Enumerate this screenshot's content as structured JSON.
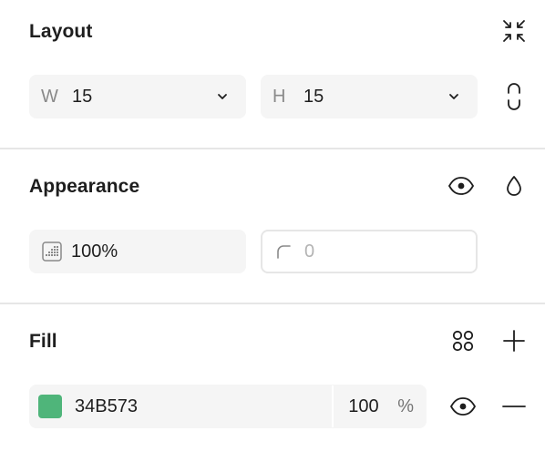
{
  "layout": {
    "title": "Layout",
    "width": {
      "prefix": "W",
      "value": "15"
    },
    "height": {
      "prefix": "H",
      "value": "15"
    },
    "icons": {
      "collapse": "collapse-icon",
      "constrain": "constrain-proportions-icon",
      "dropdown": "chevron-down-icon"
    }
  },
  "appearance": {
    "title": "Appearance",
    "opacity": {
      "value": "100%"
    },
    "corner_radius": {
      "placeholder": "0"
    },
    "icons": {
      "visibility": "eye-icon",
      "blend": "drop-icon",
      "opacity": "opacity-icon",
      "corner": "corner-radius-icon"
    }
  },
  "fill": {
    "title": "Fill",
    "hex": "34B573",
    "color": "#4fb57a",
    "opacity": "100",
    "unit": "%",
    "icons": {
      "styles": "styles-grid-icon",
      "add": "plus-icon",
      "visibility": "eye-icon",
      "remove": "minus-icon"
    }
  }
}
